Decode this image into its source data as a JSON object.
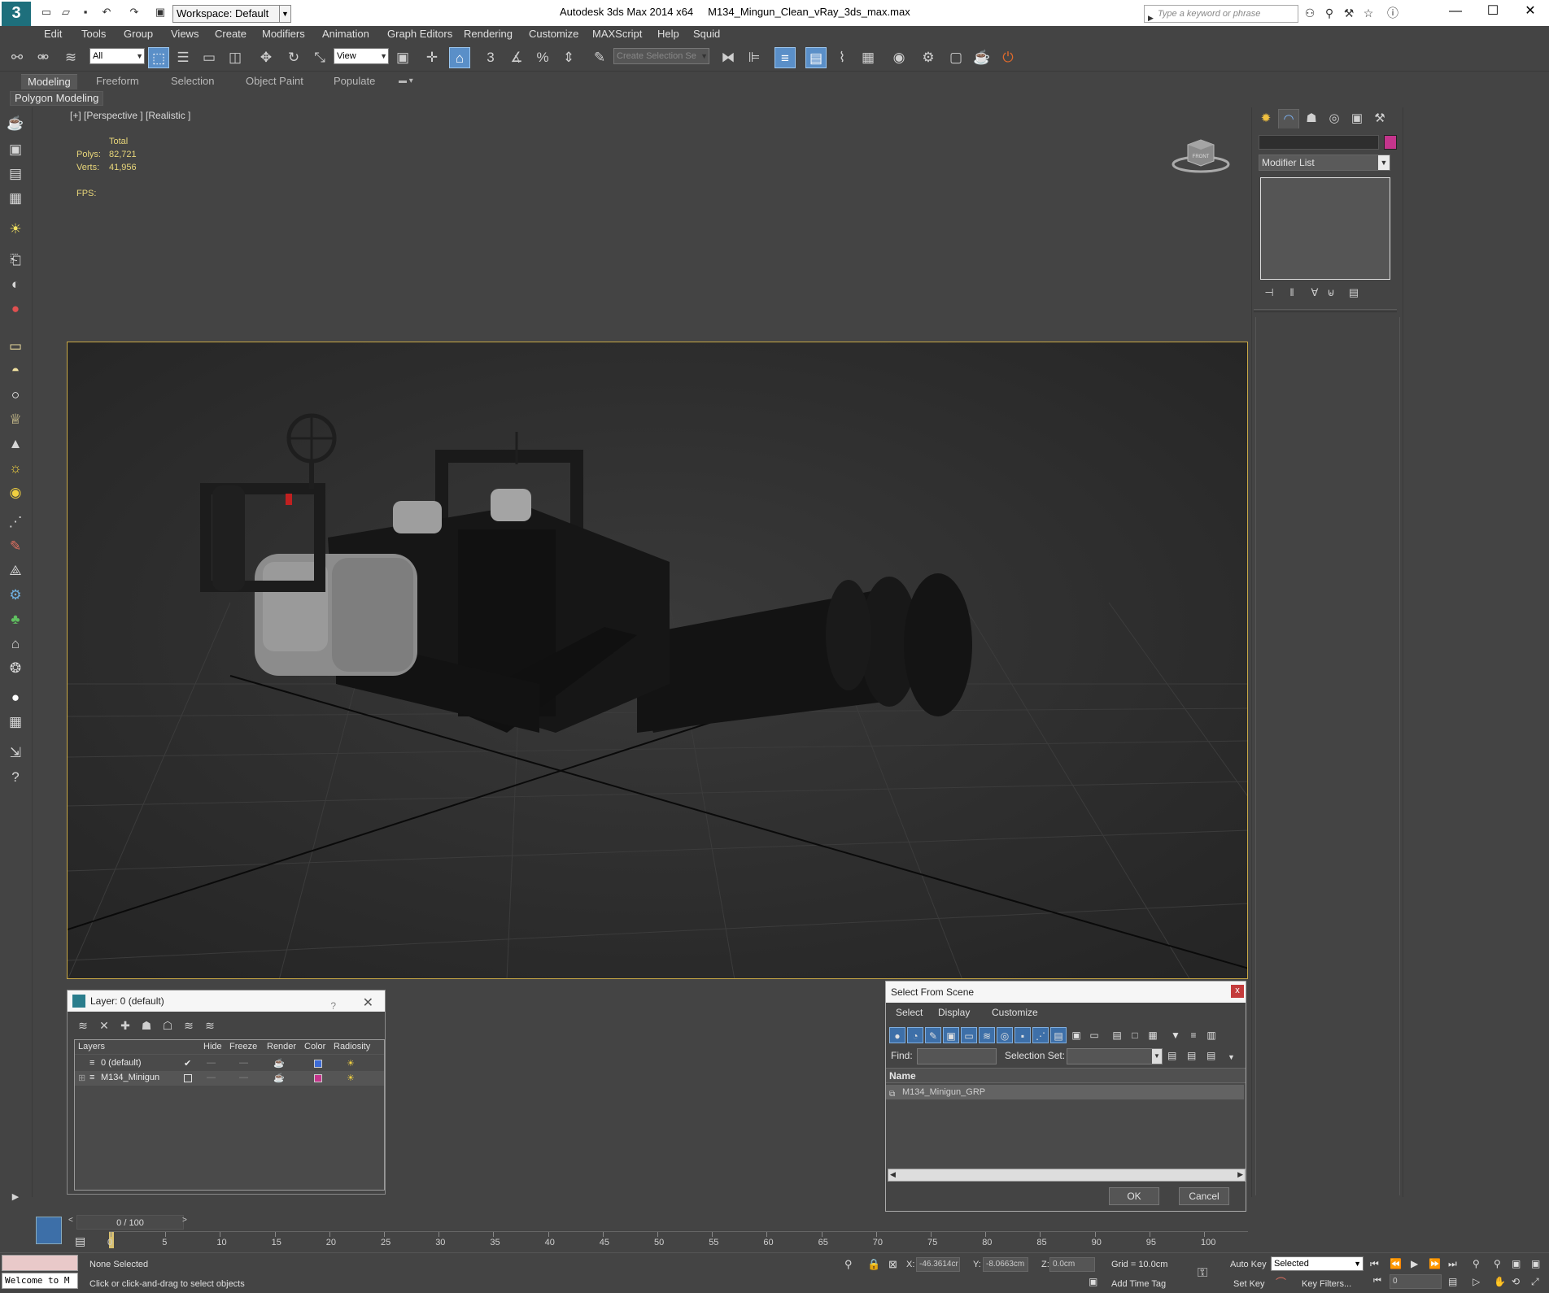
{
  "titlebar": {
    "workspace": "Workspace: Default",
    "app_title": "Autodesk 3ds Max  2014 x64",
    "file_name": "M134_Mingun_Clean_vRay_3ds_max.max",
    "search_placeholder": "Type a keyword or phrase"
  },
  "menu": [
    "Edit",
    "Tools",
    "Group",
    "Views",
    "Create",
    "Modifiers",
    "Animation",
    "Graph Editors",
    "Rendering",
    "Customize",
    "MAXScript",
    "Help",
    "Squid"
  ],
  "toolbar": {
    "selection_filter": "All",
    "reference_coord": "View",
    "named_selection": "Create Selection Se"
  },
  "ribbon": {
    "tabs": [
      "Modeling",
      "Freeform",
      "Selection",
      "Object Paint",
      "Populate"
    ],
    "panel": "Polygon Modeling"
  },
  "viewport": {
    "label": "[+] [Perspective ] [Realistic ]",
    "stats_header": "Total",
    "polys_label": "Polys:",
    "polys_value": "82,721",
    "verts_label": "Verts:",
    "verts_value": "41,956",
    "fps_label": "FPS:",
    "viewcube_label": "FRONT"
  },
  "command_panel": {
    "modifier_list": "Modifier List",
    "object_color": "#c4358c"
  },
  "layer_dialog": {
    "title": "Layer: 0 (default)",
    "help": "?",
    "columns": [
      "Layers",
      "Hide",
      "Freeze",
      "Render",
      "Color",
      "Radiosity"
    ],
    "rows": [
      {
        "name": "0 (default)",
        "color": "#3d6bd6"
      },
      {
        "name": "M134_Minigun",
        "color": "#c4358c"
      }
    ]
  },
  "select_dialog": {
    "title": "Select From Scene",
    "menu": [
      "Select",
      "Display",
      "Customize"
    ],
    "find_label": "Find:",
    "selection_set_label": "Selection Set:",
    "column_name": "Name",
    "items": [
      "M134_Minigun_GRP"
    ],
    "ok": "OK",
    "cancel": "Cancel"
  },
  "timeline": {
    "frame": "0 / 100",
    "ticks": [
      "0",
      "5",
      "10",
      "15",
      "20",
      "25",
      "30",
      "35",
      "40",
      "45",
      "50",
      "55",
      "60",
      "65",
      "70",
      "75",
      "80",
      "85",
      "90",
      "95",
      "100"
    ]
  },
  "status": {
    "maxscript": "Welcome to M",
    "selection": "None Selected",
    "prompt": "Click or click-and-drag to select objects",
    "x_label": "X:",
    "x_value": "-46.3614cr",
    "y_label": "Y:",
    "y_value": "-8.0663cm",
    "z_label": "Z:",
    "z_value": "0.0cm",
    "grid": "Grid = 10.0cm",
    "add_time_tag": "Add Time Tag",
    "auto_key": "Auto Key",
    "set_key": "Set Key",
    "key_mode": "Selected",
    "key_filters": "Key Filters...",
    "current_frame": "0"
  }
}
